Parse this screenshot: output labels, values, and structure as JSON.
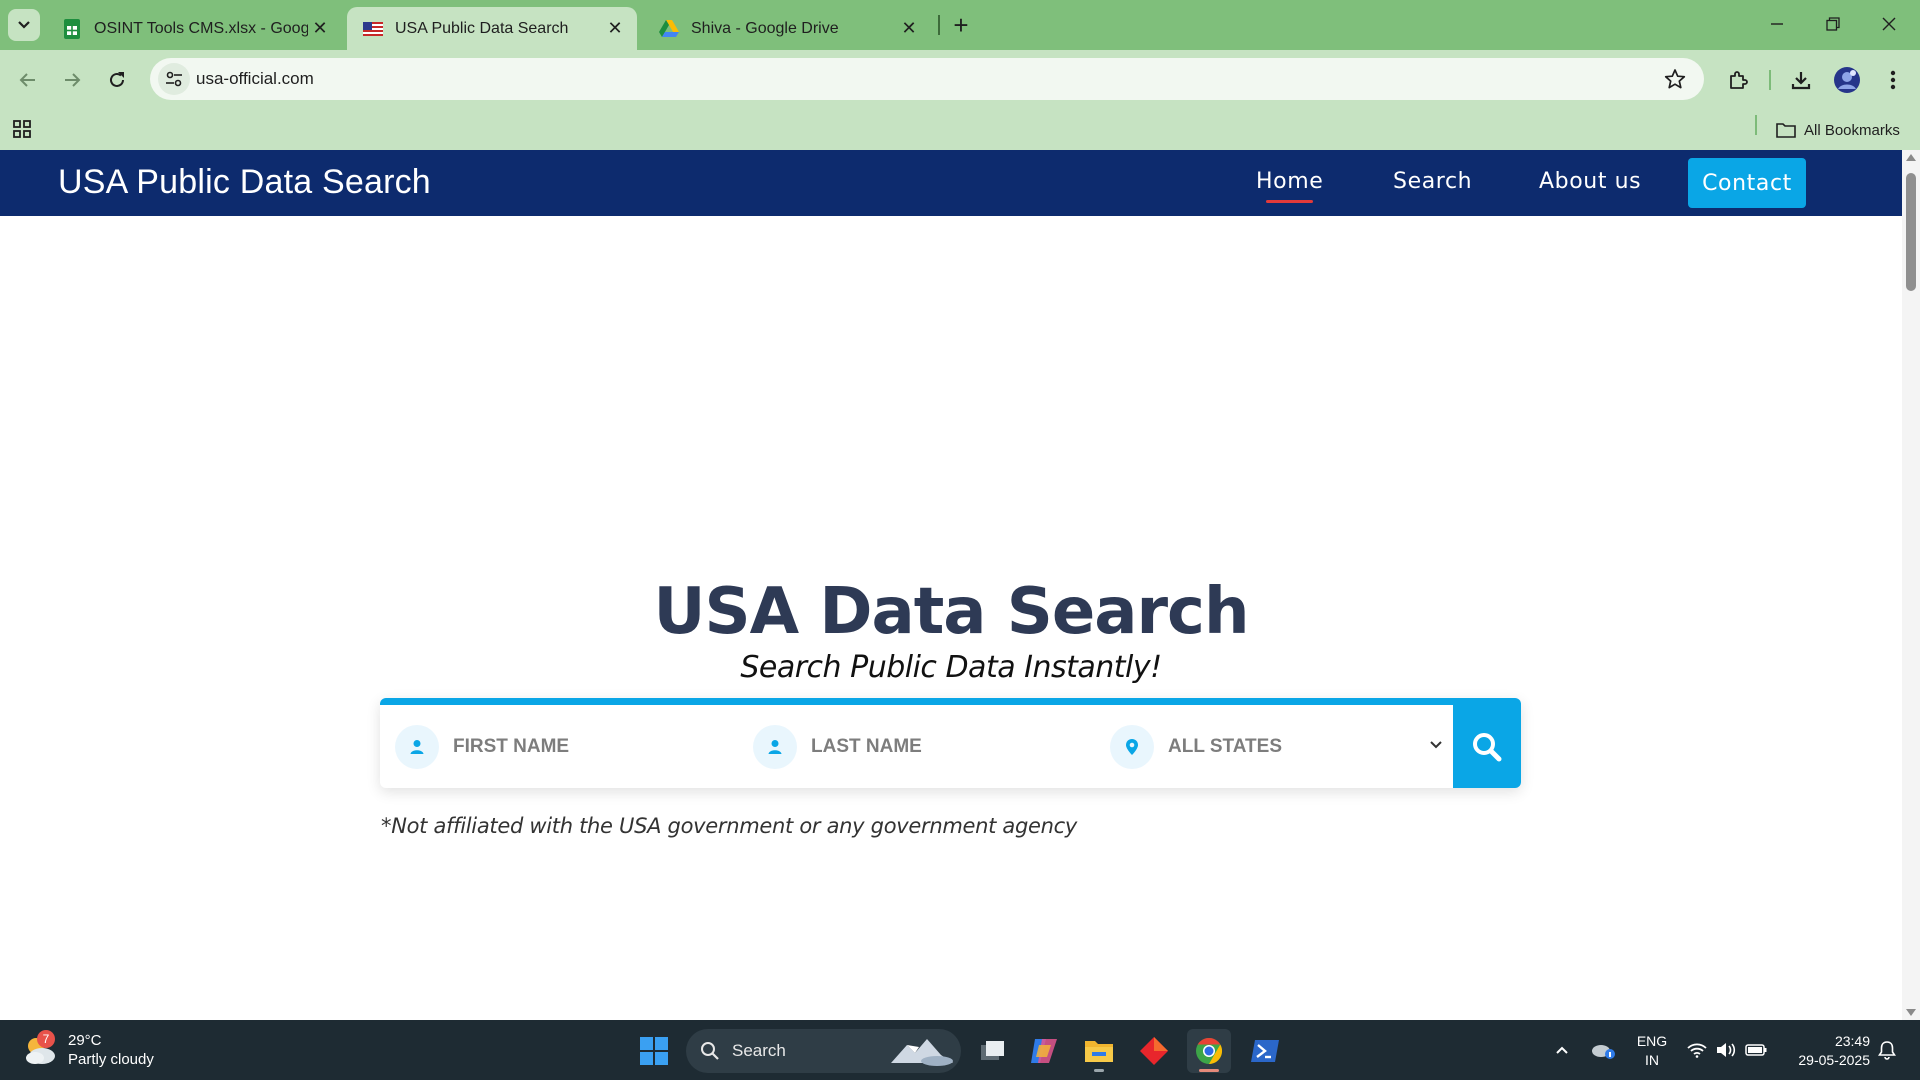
{
  "browser": {
    "tabs": [
      {
        "title": "OSINT Tools CMS.xlsx - Google",
        "icon": "google-sheets-icon",
        "active": false
      },
      {
        "title": "USA Public Data Search",
        "icon": "us-flag-icon",
        "active": true
      },
      {
        "title": "Shiva - Google Drive",
        "icon": "google-drive-icon",
        "active": false
      }
    ],
    "url": "usa-official.com",
    "bookmarks_label": "All Bookmarks"
  },
  "site": {
    "logo": "USA Public Data Search",
    "nav": {
      "home": "Home",
      "search": "Search",
      "about": "About us",
      "contact": "Contact"
    },
    "hero": {
      "title": "USA Data Search",
      "subtitle": "Search Public Data Instantly!"
    },
    "form": {
      "first_name": "FIRST NAME",
      "last_name": "LAST NAME",
      "state": "ALL STATES"
    },
    "disclaimer": "*Not affiliated with the USA government or any government agency"
  },
  "colors": {
    "nav_bg": "#0d2b6e",
    "accent": "#0aa6e6",
    "active_underline": "#e23a3a",
    "browser_frame": "#7fbf7b"
  },
  "taskbar": {
    "weather": {
      "temp": "29°C",
      "desc": "Partly cloudy",
      "badge": "7"
    },
    "search_label": "Search",
    "lang": {
      "line1": "ENG",
      "line2": "IN"
    },
    "clock": {
      "time": "23:49",
      "date": "29-05-2025"
    }
  }
}
